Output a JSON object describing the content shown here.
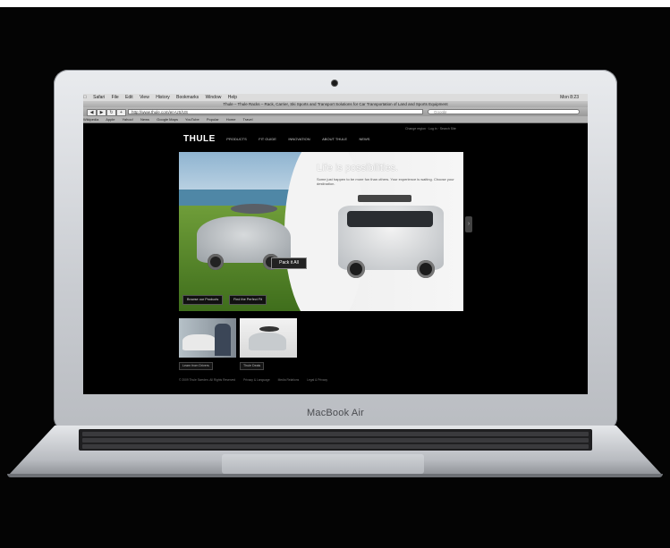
{
  "laptop": {
    "brand_label": "MacBook Air"
  },
  "os_menubar": {
    "items": [
      "Safari",
      "File",
      "Edit",
      "View",
      "History",
      "Bookmarks",
      "Window",
      "Help"
    ],
    "clock": "Mon 8:23"
  },
  "browser": {
    "window_title": "Thule – Thule Racks – Rack, Carrier, Ski Sports and Transport Solutions for Car Transportation of Land and Sports Equipment",
    "url": "http://www.thule.com/en-US/US",
    "search_placeholder": "Google",
    "bookmarks": [
      "Wikipedia",
      "Apple",
      "Yahoo!",
      "News",
      "Google Maps",
      "YouTube",
      "Popular",
      "Home",
      "Travel"
    ]
  },
  "site": {
    "logo": "THULE",
    "nav": [
      "PRODUCTS",
      "FIT GUIDE",
      "INNOVATION",
      "ABOUT THULE",
      "NEWS"
    ],
    "top_links": "Change region  ·  Log in  ·  Search Site",
    "hero": {
      "title": "Life is possibilities.",
      "subtitle": "Some just happen to be more fun than others. Your experience is waiting. Choose your destination.",
      "badge": "Pack it All",
      "buttons": [
        "Browse our Products",
        "Find the Perfect Fit"
      ]
    },
    "next_arrow": "›",
    "thumb_labels": [
      "Learn from Drivers",
      "Thule Deals"
    ],
    "footer": [
      "© 2009 Thule Sweden. All Rights Reserved",
      "Privacy & Language",
      "Media Relations",
      "Legal & Privacy"
    ]
  }
}
